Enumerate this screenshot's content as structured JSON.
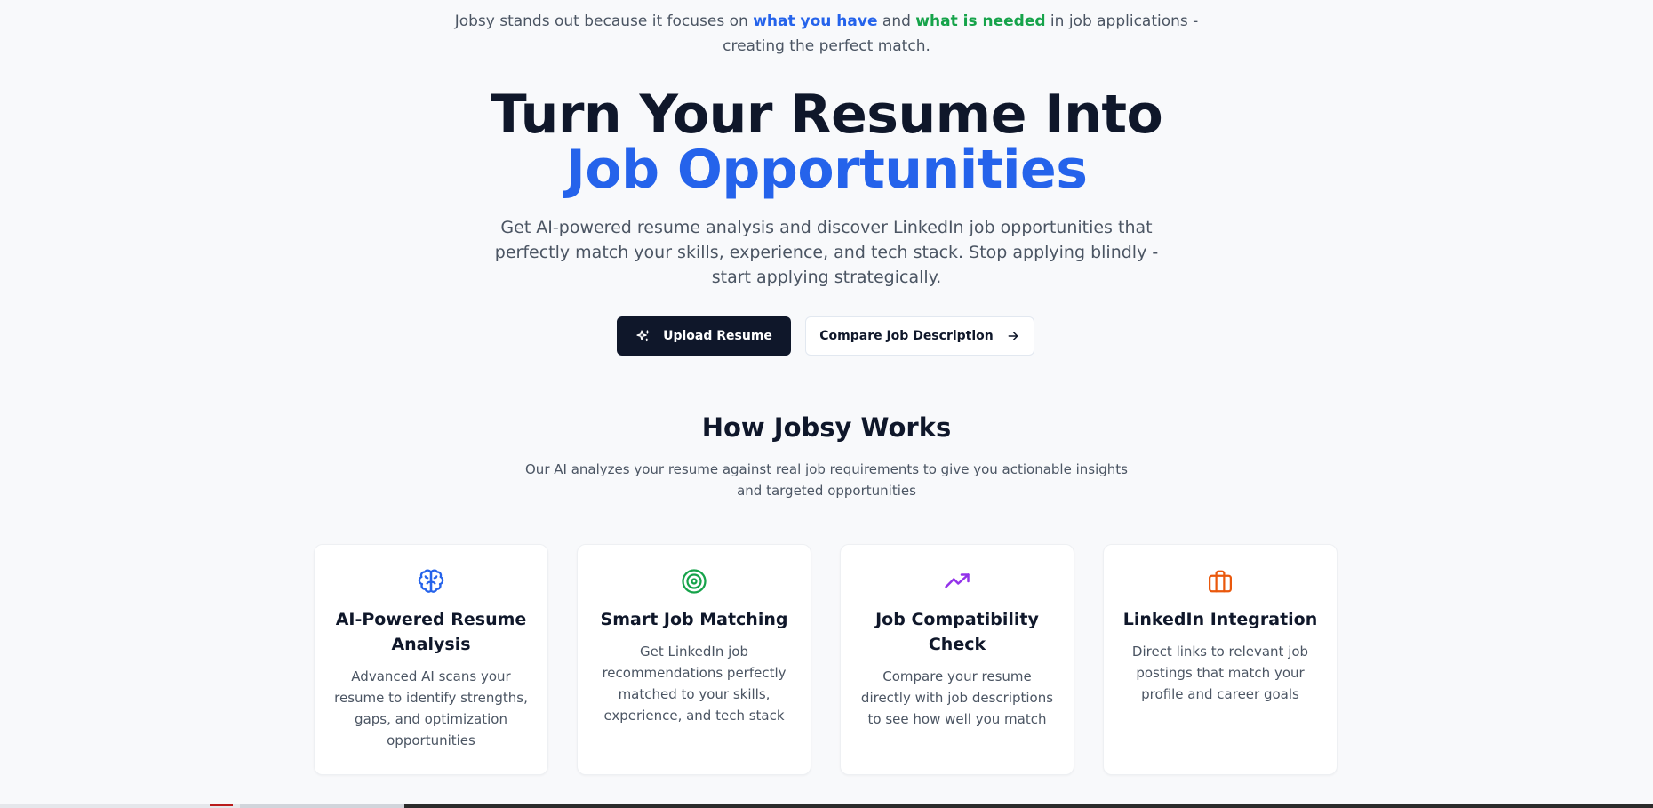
{
  "tagline": {
    "prefix": "Jobsy stands out because it focuses on ",
    "highlight_have": "what you have",
    "middle": " and ",
    "highlight_needed": "what is needed",
    "suffix": " in job applications - creating the perfect match."
  },
  "hero": {
    "title_main": "Turn Your Resume Into ",
    "title_accent": "Job Opportunities",
    "subtitle": "Get AI-powered resume analysis and discover LinkedIn job opportunities that perfectly match your skills, experience, and tech stack. Stop applying blindly - start applying strategically."
  },
  "buttons": {
    "upload_label": "Upload Resume",
    "upload_icon": "sparkles-icon",
    "compare_label": "Compare Job Description",
    "compare_icon": "arrow-right-icon"
  },
  "how_it_works": {
    "title": "How Jobsy Works",
    "subtitle": "Our AI analyzes your resume against real job requirements to give you actionable insights and targeted opportunities"
  },
  "features": [
    {
      "icon": "brain-icon",
      "icon_color": "#2563eb",
      "title": "AI-Powered Resume Analysis",
      "description": "Advanced AI scans your resume to identify strengths, gaps, and optimization opportunities"
    },
    {
      "icon": "target-icon",
      "icon_color": "#16a34a",
      "title": "Smart Job Matching",
      "description": "Get LinkedIn job recommendations perfectly matched to your skills, experience, and tech stack"
    },
    {
      "icon": "trending-up-icon",
      "icon_color": "#9333ea",
      "title": "Job Compatibility Check",
      "description": "Compare your resume directly with job descriptions to see how well you match"
    },
    {
      "icon": "briefcase-icon",
      "icon_color": "#ea580c",
      "title": "LinkedIn Integration",
      "description": "Direct links to relevant job postings that match your profile and career goals"
    }
  ]
}
